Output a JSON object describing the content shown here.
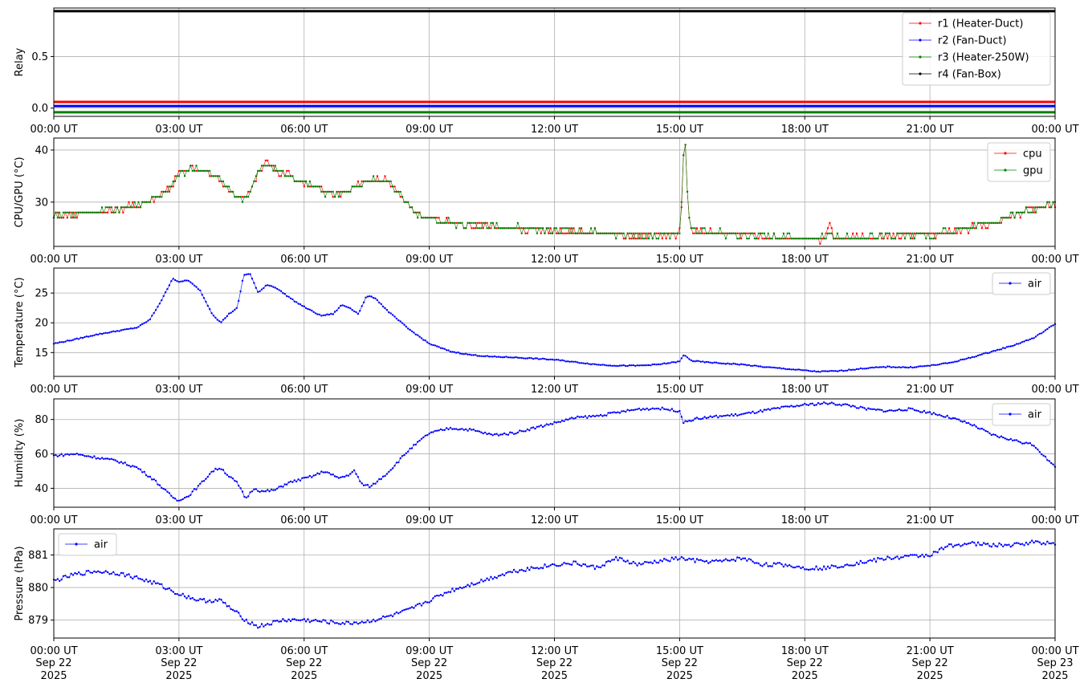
{
  "colors": {
    "red": "#ff0000",
    "blue": "#0000ff",
    "green": "#008000",
    "black": "#000000",
    "grid": "#b0b0b0"
  },
  "x_ticks": [
    {
      "t": 0,
      "label": "00:00 UT"
    },
    {
      "t": 3,
      "label": "03:00 UT"
    },
    {
      "t": 6,
      "label": "06:00 UT"
    },
    {
      "t": 9,
      "label": "09:00 UT"
    },
    {
      "t": 12,
      "label": "12:00 UT"
    },
    {
      "t": 15,
      "label": "15:00 UT"
    },
    {
      "t": 18,
      "label": "18:00 UT"
    },
    {
      "t": 21,
      "label": "21:00 UT"
    },
    {
      "t": 24,
      "label": "00:00 UT"
    }
  ],
  "date_labels": [
    {
      "t": 0,
      "date": "Sep 22",
      "year": "2025"
    },
    {
      "t": 3,
      "date": "Sep 22",
      "year": "2025"
    },
    {
      "t": 6,
      "date": "Sep 22",
      "year": "2025"
    },
    {
      "t": 9,
      "date": "Sep 22",
      "year": "2025"
    },
    {
      "t": 12,
      "date": "Sep 22",
      "year": "2025"
    },
    {
      "t": 15,
      "date": "Sep 22",
      "year": "2025"
    },
    {
      "t": 18,
      "date": "Sep 22",
      "year": "2025"
    },
    {
      "t": 21,
      "date": "Sep 22",
      "year": "2025"
    },
    {
      "t": 24,
      "date": "Sep 23",
      "year": "2025"
    }
  ],
  "chart_data": [
    {
      "type": "line",
      "ylabel": "Relay",
      "ylim": [
        -0.08,
        0.97
      ],
      "yticks": [
        {
          "v": 0.0,
          "label": "0.0"
        },
        {
          "v": 0.5,
          "label": "0.5"
        }
      ],
      "grid": true,
      "legend_position": "top-right",
      "series": [
        {
          "name": "r1 (Heater-Duct)",
          "color": "#ff0000",
          "const": 0.06
        },
        {
          "name": "r2 (Fan-Duct)",
          "color": "#0000ff",
          "const": 0.02
        },
        {
          "name": "r3 (Heater-250W)",
          "color": "#008000",
          "const": -0.04
        },
        {
          "name": "r4 (Fan-Box)",
          "color": "#000000",
          "const": 0.94
        }
      ]
    },
    {
      "type": "line",
      "ylabel": "CPU/GPU (°C)",
      "ylim": [
        21.5,
        42.3
      ],
      "yticks": [
        {
          "v": 30,
          "label": "30"
        },
        {
          "v": 40,
          "label": "40"
        }
      ],
      "grid": true,
      "legend_position": "top-right",
      "series": [
        {
          "name": "cpu",
          "color": "#ff0000",
          "x": [
            0,
            0.5,
            1,
            1.5,
            2,
            2.5,
            2.8,
            3,
            3.3,
            3.6,
            3.9,
            4.1,
            4.3,
            4.5,
            4.7,
            4.9,
            5.1,
            5.3,
            5.6,
            5.9,
            6.2,
            6.5,
            6.7,
            6.9,
            7.1,
            7.4,
            7.7,
            8,
            8.3,
            8.6,
            8.9,
            9.3,
            9.8,
            10.5,
            11.2,
            12,
            12.8,
            13.5,
            14.2,
            14.9,
            15.0,
            15.05,
            15.1,
            15.15,
            15.2,
            15.3,
            15.6,
            16,
            16.5,
            17,
            17.5,
            18,
            18.5,
            18.6,
            18.65,
            18.7,
            19,
            19.5,
            20,
            20.5,
            21,
            21.5,
            22,
            22.5,
            23,
            23.5,
            24
          ],
          "values": [
            27.5,
            27.8,
            28.0,
            28.5,
            29.5,
            31,
            33,
            35.5,
            36.5,
            36.0,
            35.0,
            33.5,
            31.5,
            30.5,
            32,
            35.5,
            37.8,
            36,
            35.5,
            34,
            33,
            32,
            31.5,
            31.8,
            32.5,
            33.5,
            34.5,
            34.0,
            31.5,
            28.5,
            27,
            26.2,
            25.8,
            25.4,
            25.0,
            24.6,
            24.2,
            23.8,
            23.6,
            23.8,
            24.5,
            30,
            40,
            41.2,
            27,
            24.5,
            24.2,
            24.0,
            23.6,
            23.4,
            23.2,
            23.0,
            23.0,
            26.3,
            24,
            23.2,
            23.0,
            23.2,
            23.4,
            23.6,
            23.8,
            24.2,
            25.0,
            26.0,
            27.5,
            28.5,
            30.0
          ]
        },
        {
          "name": "gpu",
          "color": "#008000",
          "x": [
            0,
            0.5,
            1,
            1.5,
            2,
            2.5,
            2.8,
            3,
            3.3,
            3.6,
            3.9,
            4.1,
            4.3,
            4.5,
            4.7,
            4.9,
            5.1,
            5.3,
            5.6,
            5.9,
            6.2,
            6.5,
            6.7,
            6.9,
            7.1,
            7.4,
            7.7,
            8,
            8.3,
            8.6,
            8.9,
            9.3,
            9.8,
            10.5,
            11.2,
            12,
            12.8,
            13.5,
            14.2,
            14.9,
            15.0,
            15.05,
            15.1,
            15.15,
            15.2,
            15.3,
            15.6,
            16,
            16.5,
            17,
            17.5,
            18,
            18.5,
            18.6,
            18.65,
            18.7,
            19,
            19.5,
            20,
            20.5,
            21,
            21.5,
            22,
            22.5,
            23,
            23.5,
            24
          ],
          "values": [
            27.5,
            27.8,
            28.0,
            28.5,
            29.5,
            31,
            33,
            35.5,
            36.5,
            36.0,
            35.0,
            33.5,
            31.5,
            30.5,
            32,
            35.5,
            37.8,
            36,
            35.5,
            34,
            33,
            32,
            31.5,
            31.8,
            32.5,
            33.5,
            34.5,
            34.0,
            31.5,
            28.5,
            27,
            26.2,
            25.8,
            25.4,
            25.0,
            24.6,
            24.2,
            23.8,
            23.6,
            23.8,
            24.5,
            30,
            40,
            41.2,
            27,
            24.5,
            24.2,
            24.0,
            23.6,
            23.4,
            23.2,
            23.0,
            23.0,
            24.5,
            24,
            23.2,
            23.0,
            23.2,
            23.4,
            23.6,
            23.8,
            24.2,
            25.0,
            26.0,
            27.5,
            28.5,
            30.0
          ]
        }
      ]
    },
    {
      "type": "line",
      "ylabel": "Temperature (°C)",
      "ylim": [
        11.0,
        29.2
      ],
      "yticks": [
        {
          "v": 15,
          "label": "15"
        },
        {
          "v": 20,
          "label": "20"
        },
        {
          "v": 25,
          "label": "25"
        }
      ],
      "grid": true,
      "legend_position": "top-right",
      "series": [
        {
          "name": "air",
          "color": "#0000ff",
          "x": [
            0,
            0.5,
            1,
            1.5,
            2,
            2.3,
            2.6,
            2.85,
            3.0,
            3.2,
            3.5,
            3.8,
            4.0,
            4.2,
            4.4,
            4.55,
            4.7,
            4.9,
            5.1,
            5.3,
            5.5,
            5.8,
            6.1,
            6.4,
            6.7,
            6.9,
            7.1,
            7.3,
            7.5,
            7.7,
            8,
            8.5,
            9,
            9.5,
            10,
            10.5,
            11,
            11.5,
            12,
            12.5,
            13,
            13.5,
            14,
            14.5,
            15,
            15.1,
            15.3,
            15.6,
            16,
            16.5,
            17,
            17.5,
            18,
            18.3,
            18.8,
            19.5,
            20,
            20.5,
            21,
            21.5,
            22,
            22.5,
            23,
            23.5,
            24
          ],
          "values": [
            16.5,
            17.2,
            18.0,
            18.6,
            19.2,
            20.5,
            24.0,
            27.5,
            26.8,
            27.2,
            25.5,
            21.5,
            20.0,
            21.5,
            22.5,
            28.0,
            28.3,
            25.0,
            26.4,
            26.0,
            25.0,
            23.5,
            22.3,
            21.2,
            21.5,
            23.0,
            22.5,
            21.5,
            24.5,
            24.2,
            22.0,
            19.0,
            16.5,
            15.2,
            14.6,
            14.3,
            14.2,
            14.0,
            13.8,
            13.4,
            13.0,
            12.8,
            12.8,
            13.0,
            13.5,
            14.6,
            13.6,
            13.4,
            13.2,
            13.0,
            12.6,
            12.3,
            12.0,
            11.8,
            11.9,
            12.4,
            12.6,
            12.5,
            12.8,
            13.3,
            14.2,
            15.2,
            16.2,
            17.5,
            19.8
          ]
        }
      ]
    },
    {
      "type": "line",
      "ylabel": "Humidity (%)",
      "ylim": [
        29.0,
        92.0
      ],
      "yticks": [
        {
          "v": 40,
          "label": "40"
        },
        {
          "v": 60,
          "label": "60"
        },
        {
          "v": 80,
          "label": "80"
        }
      ],
      "grid": true,
      "legend_position": "top-right",
      "series": [
        {
          "name": "air",
          "color": "#0000ff",
          "x": [
            0,
            0.5,
            1,
            1.5,
            2,
            2.4,
            2.7,
            2.95,
            3.2,
            3.5,
            3.8,
            4.0,
            4.2,
            4.4,
            4.6,
            4.8,
            5.0,
            5.3,
            5.6,
            5.9,
            6.2,
            6.5,
            6.8,
            7.0,
            7.2,
            7.4,
            7.6,
            8,
            8.5,
            9,
            9.5,
            10,
            10.5,
            11,
            11.5,
            12,
            12.5,
            13,
            13.5,
            14,
            14.5,
            15,
            15.1,
            15.3,
            15.6,
            16,
            16.5,
            17,
            17.5,
            18,
            18.5,
            19,
            19.5,
            20,
            20.5,
            21,
            21.5,
            22,
            22.5,
            23,
            23.5,
            24
          ],
          "values": [
            59,
            60,
            58,
            56,
            52,
            45,
            38,
            33,
            35,
            42,
            50,
            52,
            47,
            43,
            34,
            40,
            38,
            39,
            43,
            45,
            47,
            50,
            46,
            47,
            50,
            42,
            41,
            49,
            62,
            72,
            75,
            74,
            71,
            72,
            75,
            78,
            81,
            82,
            84,
            86,
            86.5,
            85,
            78,
            80,
            81,
            82,
            83,
            85,
            87,
            88.5,
            89.5,
            88.5,
            86,
            85,
            86,
            84,
            81,
            77,
            71,
            68,
            65,
            52
          ]
        }
      ]
    },
    {
      "type": "line",
      "ylabel": "Pressure (hPa)",
      "ylim": [
        878.45,
        881.8
      ],
      "yticks": [
        {
          "v": 879,
          "label": "879"
        },
        {
          "v": 880,
          "label": "880"
        },
        {
          "v": 881,
          "label": "881"
        }
      ],
      "grid": true,
      "legend_position": "top-left",
      "series": [
        {
          "name": "air",
          "color": "#0000ff",
          "x": [
            0,
            0.5,
            1,
            1.5,
            2,
            2.5,
            3,
            3.5,
            4,
            4.3,
            4.6,
            4.9,
            5.2,
            5.5,
            6,
            6.5,
            7,
            7.5,
            8,
            8.5,
            9,
            9.5,
            10,
            10.5,
            11,
            11.5,
            12,
            12.5,
            13,
            13.5,
            14,
            14.5,
            15,
            15.5,
            16,
            16.5,
            17,
            17.5,
            18,
            18.5,
            19,
            19.5,
            20,
            20.5,
            21,
            21.5,
            22,
            22.5,
            23,
            23.5,
            24
          ],
          "values": [
            880.2,
            880.4,
            880.5,
            880.45,
            880.3,
            880.1,
            879.8,
            879.6,
            879.6,
            879.3,
            879.0,
            878.8,
            878.9,
            879.0,
            879.0,
            878.95,
            878.9,
            878.95,
            879.1,
            879.3,
            879.6,
            879.9,
            880.1,
            880.3,
            880.5,
            880.6,
            880.7,
            880.75,
            880.6,
            880.9,
            880.7,
            880.8,
            880.9,
            880.8,
            880.8,
            880.9,
            880.7,
            880.7,
            880.6,
            880.6,
            880.7,
            880.8,
            880.9,
            880.95,
            881.0,
            881.3,
            881.35,
            881.3,
            881.3,
            881.4,
            881.35
          ]
        }
      ]
    }
  ]
}
